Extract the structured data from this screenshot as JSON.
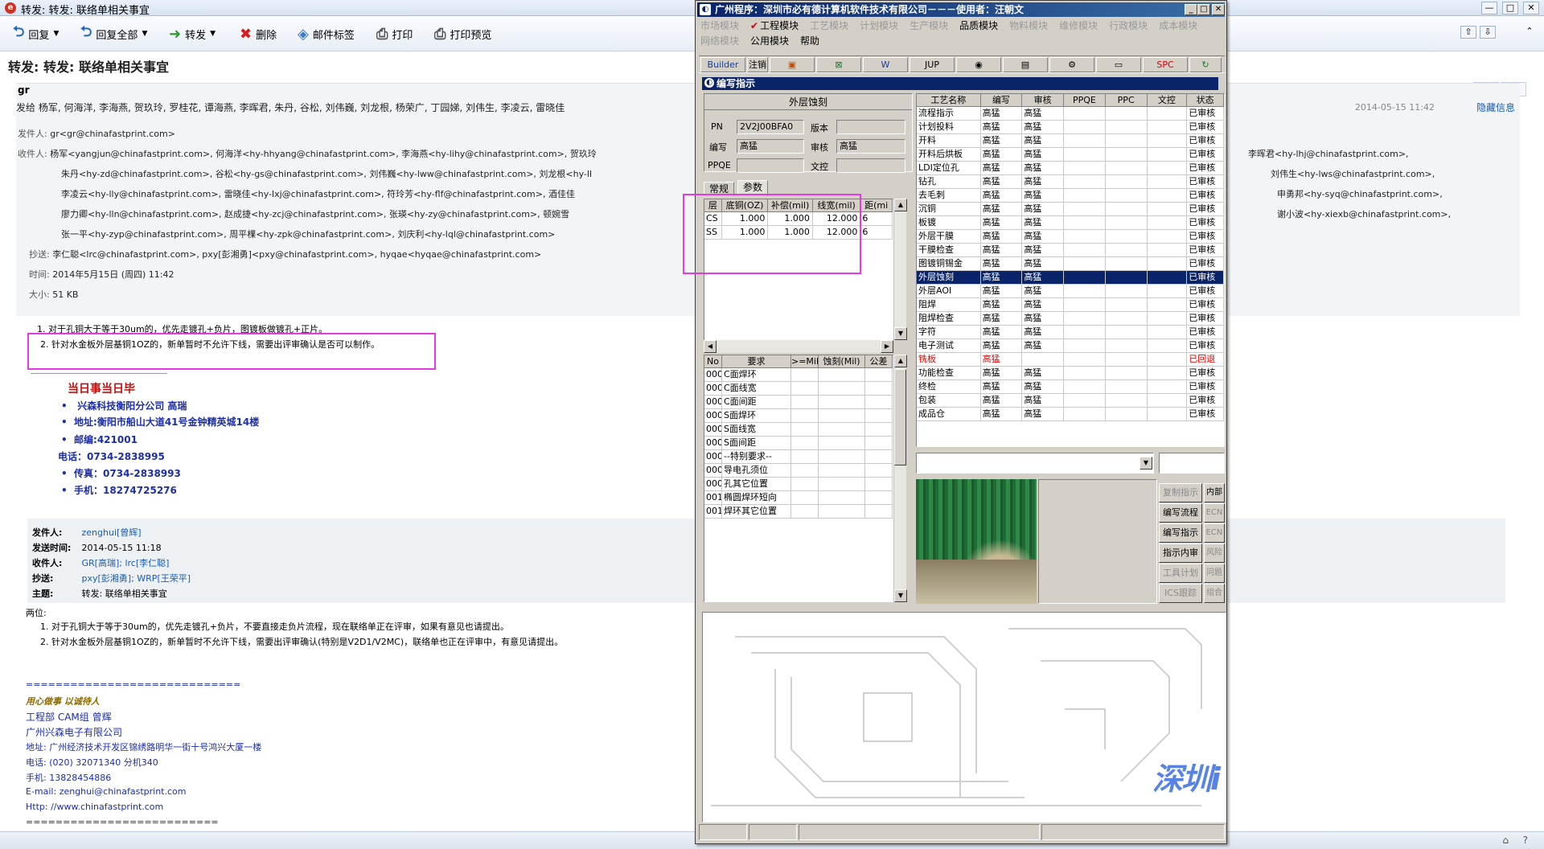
{
  "email": {
    "window_title": "转发: 转发: 联络单相关事宜",
    "toolbar": {
      "reply": "回复",
      "reply_all": "回复全部",
      "forward": "转发",
      "delete": "删除",
      "tag": "邮件标签",
      "print": "打印",
      "print_preview": "打印预览"
    },
    "subject": "转发: 转发: 联络单相关事宜",
    "sender_short": "gr",
    "send_to_line": "发给 杨军, 何海洋, 李海燕, 贺玖玲, 罗桂花, 谭海燕, 李晖君, 朱丹, 谷松, 刘伟巍, 刘龙根, 杨荣广, 丁园娣, 刘伟生, 李凌云, 雷晓佳",
    "date": "2014-05-15 11:42",
    "hide_info": "隐藏信息",
    "from_label": "发件人:",
    "from_value": "gr<gr@chinafastprint.com>",
    "to_label": "收件人:",
    "to_lines": [
      "杨军<yangjun@chinafastprint.com>,   何海洋<hy-hhyang@chinafastprint.com>,   李海燕<hy-lihy@chinafastprint.com>,   贺玖玲",
      "朱丹<hy-zd@chinafastprint.com>,   谷松<hy-gs@chinafastprint.com>,   刘伟巍<hy-lww@chinafastprint.com>,   刘龙根<hy-ll",
      "李凌云<hy-lly@chinafastprint.com>,   雷晓佳<hy-lxj@chinafastprint.com>,   符玲芳<hy-flf@chinafastprint.com>,   酒佳佳",
      "廖力卿<hy-lln@chinafastprint.com>,   赵成捷<hy-zcj@chinafastprint.com>,   张瑛<hy-zy@chinafastprint.com>,   顿婉雪",
      "张一平<hy-zyp@chinafastprint.com>,   周平棵<hy-zpk@chinafastprint.com>,   刘庆利<hy-lql@chinafastprint.com>"
    ],
    "to_right_lines": [
      "李晖君<hy-lhj@chinafastprint.com>,",
      "刘伟生<hy-lws@chinafastprint.com>,",
      "申勇邦<hy-syq@chinafastprint.com>,",
      "谢小波<hy-xiexb@chinafastprint.com>,"
    ],
    "cc_label": "抄送:",
    "cc_value": "李仁聪<lrc@chinafastprint.com>,   pxy[彭湘勇]<pxy@chinafastprint.com>,   hyqae<hyqae@chinafastprint.com>",
    "time_label": "时间:",
    "time_value": "2014年5月15日 (周四) 11:42",
    "size_label": "大小:",
    "size_value": "51 KB",
    "body_item1": "1. 对于孔铜大于等于30um的，优先走镀孔+负片，图镀板做镀孔+正片。",
    "body_item2": "2. 针对水金板外层基铜1OZ的，新单暂时不允许下线，需要出评审确认是否可以制作。",
    "sig_slogan": "当日事当日毕",
    "sig_company": "兴森科技衡阳分公司   高瑞",
    "sig_addr": "地址:衡阳市船山大道41号金钟精英城14楼",
    "sig_zip": "邮编:421001",
    "sig_phone": "电话：0734-2838995",
    "sig_fax": "传真：0734-2838993",
    "sig_mobile": "手机：18274725276",
    "q_from_label": "发件人:",
    "q_from": "zenghui[曾辉]",
    "q_time_label": "发送时间:",
    "q_time": "2014-05-15 11:18",
    "q_to_label": "收件人:",
    "q_to": "GR[高瑞]; lrc[李仁聪]",
    "q_cc_label": "抄送:",
    "q_cc": "pxy[彭湘勇]; WRP[王荣平]",
    "q_subj_label": "主题:",
    "q_subj": "转发: 联络单相关事宜",
    "q_greet": "两位:",
    "q_item1": "1. 对于孔铜大于等于30um的，优先走镀孔+负片，不要直接走负片流程，现在联络单正在评审，如果有意见也请提出。",
    "q_item2": "2. 针对水金板外层基铜1OZ的，新单暂时不允许下线，需要出评审确认(特别是V2D1/V2MC)，联络单也正在评审中，有意见请提出。",
    "s2_line1": "=============================",
    "s2_motto": "用心做事   以诚待人",
    "s2_dept": "工程部  CAM组  曾辉",
    "s2_company": "广州兴森电子有限公司",
    "s2_addr": "地址: 广州经济技术开发区锦绣路明华一街十号鸿兴大厦一楼",
    "s2_tel": "电话: (020) 32071340 分机340",
    "s2_mobile": "手机: 13828454886",
    "s2_email": "E-mail: zenghui@chinafastprint.com",
    "s2_http": "Http: //www.chinafastprint.com",
    "s2_line2": "=========================="
  },
  "erp": {
    "title": "广州程序：深圳市必有德计算机软件技术有限公司－－－使用者：汪朝文",
    "menu_row1": [
      "市场模块",
      "工程模块",
      "工艺模块",
      "计划模块",
      "生产模块",
      "品质模块",
      "物料模块",
      "维修模块",
      "行政模块",
      "成本模块"
    ],
    "menu_row2": [
      "网络模块",
      "公用模块",
      "帮助"
    ],
    "toolbar": {
      "builder": "Builder",
      "note": "注销",
      "jup": "JUP",
      "spc": "SPC"
    },
    "subwin_title": "编写指示",
    "section_title": "外层蚀刻",
    "pn_label": "PN",
    "pn_value": "2V2J00BFA0",
    "ver_label": "版本",
    "writer_label": "编写",
    "writer_value": "高猛",
    "audit_label": "审核",
    "audit_value": "高猛",
    "ppqe_label": "PPQE",
    "wenkong_label": "文控",
    "tab_normal": "常规",
    "tab_params": "参数",
    "param_headers": [
      "层",
      "底铜(OZ)",
      "补偿(mil)",
      "线宽(mil)",
      "距(mi"
    ],
    "param_rows": [
      [
        "CS",
        "1.000",
        "1.000",
        "12.000",
        "6"
      ],
      [
        "SS",
        "1.000",
        "1.000",
        "12.000",
        "6"
      ]
    ],
    "req_headers": [
      "No",
      "要求",
      ">=Mil",
      "蚀刻(Mil)",
      "公差"
    ],
    "req_rows": [
      [
        "000",
        "C面焊环"
      ],
      [
        "000",
        "C面线宽"
      ],
      [
        "000",
        "C面间距"
      ],
      [
        "000",
        "S面焊环"
      ],
      [
        "000",
        "S面线宽"
      ],
      [
        "000",
        "S面间距"
      ],
      [
        "000",
        "--特别要求--"
      ],
      [
        "000",
        "导电孔须位"
      ],
      [
        "000",
        "孔其它位置"
      ],
      [
        "001",
        "椭圆焊环短向"
      ],
      [
        "001",
        "焊环其它位置"
      ]
    ],
    "proc_headers": [
      "工艺名称",
      "编写",
      "审核",
      "PPQE",
      "PPC",
      "文控",
      "状态"
    ],
    "proc_rows": [
      [
        "流程指示",
        "高猛",
        "高猛",
        "",
        "",
        "",
        "已审核"
      ],
      [
        "计划投料",
        "高猛",
        "高猛",
        "",
        "",
        "",
        "已审核"
      ],
      [
        "开料",
        "高猛",
        "高猛",
        "",
        "",
        "",
        "已审核"
      ],
      [
        "开料后烘板",
        "高猛",
        "高猛",
        "",
        "",
        "",
        "已审核"
      ],
      [
        "LDI定位孔",
        "高猛",
        "高猛",
        "",
        "",
        "",
        "已审核"
      ],
      [
        "钻孔",
        "高猛",
        "高猛",
        "",
        "",
        "",
        "已审核"
      ],
      [
        "去毛刺",
        "高猛",
        "高猛",
        "",
        "",
        "",
        "已审核"
      ],
      [
        "沉铜",
        "高猛",
        "高猛",
        "",
        "",
        "",
        "已审核"
      ],
      [
        "板镀",
        "高猛",
        "高猛",
        "",
        "",
        "",
        "已审核"
      ],
      [
        "外层干膜",
        "高猛",
        "高猛",
        "",
        "",
        "",
        "已审核"
      ],
      [
        "干膜检查",
        "高猛",
        "高猛",
        "",
        "",
        "",
        "已审核"
      ],
      [
        "图镀铜锡金",
        "高猛",
        "高猛",
        "",
        "",
        "",
        "已审核"
      ],
      [
        "外层蚀刻",
        "高猛",
        "高猛",
        "",
        "",
        "",
        "已审核"
      ],
      [
        "外层AOI",
        "高猛",
        "高猛",
        "",
        "",
        "",
        "已审核"
      ],
      [
        "阻焊",
        "高猛",
        "高猛",
        "",
        "",
        "",
        "已审核"
      ],
      [
        "阻焊检查",
        "高猛",
        "高猛",
        "",
        "",
        "",
        "已审核"
      ],
      [
        "字符",
        "高猛",
        "高猛",
        "",
        "",
        "",
        "已审核"
      ],
      [
        "电子测试",
        "高猛",
        "高猛",
        "",
        "",
        "",
        "已审核"
      ],
      [
        "铣板",
        "高猛",
        "",
        "",
        "",
        "",
        "已回退"
      ],
      [
        "功能检查",
        "高猛",
        "高猛",
        "",
        "",
        "",
        "已审核"
      ],
      [
        "终检",
        "高猛",
        "高猛",
        "",
        "",
        "",
        "已审核"
      ],
      [
        "包装",
        "高猛",
        "高猛",
        "",
        "",
        "",
        "已审核"
      ],
      [
        "成品仓",
        "高猛",
        "高猛",
        "",
        "",
        "",
        "已审核"
      ]
    ],
    "side_buttons": [
      "复制指示",
      "编写流程",
      "编写指示",
      "指示内审",
      "工具计划",
      "ICS跟踪"
    ],
    "side_buttons2": [
      "内部",
      "ECN",
      "ECN",
      "风险",
      "问题",
      "组合"
    ],
    "watermark": "深圳i"
  }
}
